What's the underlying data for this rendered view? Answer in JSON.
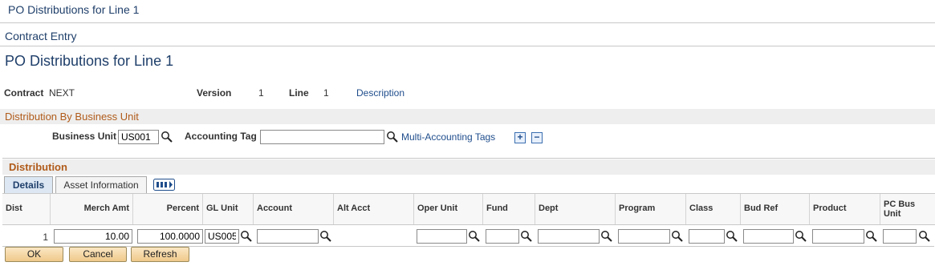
{
  "header": {
    "window_title": "PO Distributions for Line 1",
    "breadcrumb": "Contract Entry",
    "page_title": "PO Distributions for Line 1"
  },
  "info": {
    "contract_label": "Contract",
    "contract_value": "NEXT",
    "version_label": "Version",
    "version_value": "1",
    "line_label": "Line",
    "line_value": "1",
    "description_link": "Description"
  },
  "dist_by_bu": {
    "title": "Distribution By Business Unit",
    "business_unit_label": "Business Unit",
    "business_unit_value": "US001",
    "accounting_tag_label": "Accounting Tag",
    "accounting_tag_value": "",
    "multi_accounting_link": "Multi-Accounting Tags",
    "add_label": "+",
    "remove_label": "−"
  },
  "distribution": {
    "title": "Distribution",
    "tabs": [
      "Details",
      "Asset Information"
    ],
    "active_tab": "Details",
    "columns": [
      "Dist",
      "Merch Amt",
      "Percent",
      "GL Unit",
      "Account",
      "Alt Acct",
      "Oper Unit",
      "Fund",
      "Dept",
      "Program",
      "Class",
      "Bud Ref",
      "Product",
      "PC Bus Unit"
    ],
    "rows": [
      {
        "dist": "1",
        "merch_amt": "10.00",
        "percent": "100.0000",
        "gl_unit": "US005",
        "account": "",
        "alt_acct": "",
        "oper_unit": "",
        "fund": "",
        "dept": "",
        "program": "",
        "class": "",
        "bud_ref": "",
        "product": "",
        "pc_bus_unit": ""
      }
    ]
  },
  "buttons": {
    "ok": "OK",
    "cancel": "Cancel",
    "refresh": "Refresh"
  },
  "icons": {
    "lookup": "magnifier-icon",
    "show_all_columns": "show-all-columns-icon"
  },
  "colors": {
    "title_blue": "#1f3f6a",
    "section_orange": "#b05b1a",
    "link_blue": "#1f4d8c",
    "button_fill": "#efc98a"
  }
}
